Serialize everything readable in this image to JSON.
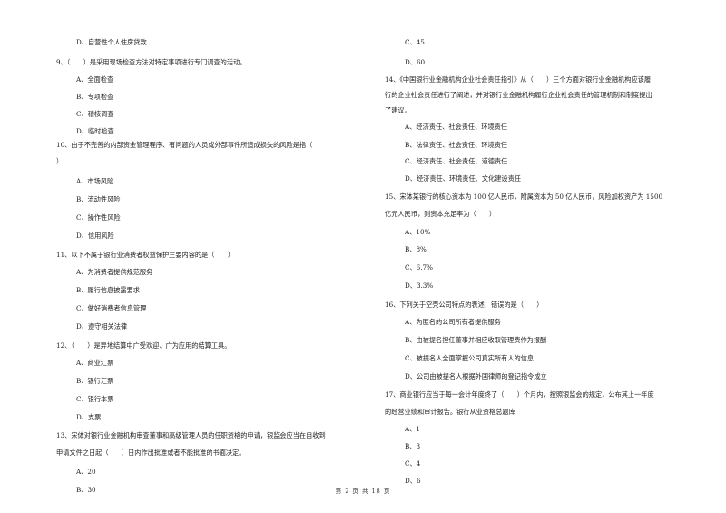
{
  "left_column": [
    {
      "type": "option",
      "text": "D、自营性个人住房贷款"
    },
    {
      "type": "question",
      "text": "9、（　　）是采用现场检查方法对特定事项进行专门调查的活动。"
    },
    {
      "type": "option",
      "text": "A、全面检查"
    },
    {
      "type": "option",
      "text": "B、专项检查"
    },
    {
      "type": "option",
      "text": "C、稽核调查"
    },
    {
      "type": "option",
      "text": "D、临时检查"
    },
    {
      "type": "question",
      "text": "10、由于不完善的内部资金管理程序、有问题的人员或外部事件所造成损失的风险是指（"
    },
    {
      "type": "question-cont",
      "text": "）"
    },
    {
      "type": "option",
      "text": "A、市场风险"
    },
    {
      "type": "option",
      "text": "B、流动性风险"
    },
    {
      "type": "option",
      "text": "C、操作性风险"
    },
    {
      "type": "option",
      "text": "D、信用风险"
    },
    {
      "type": "question",
      "text": "11、以下不属于银行业消费者权益保护主要内容的是（　　）"
    },
    {
      "type": "option",
      "text": "A、为消费者提供规范服务"
    },
    {
      "type": "option",
      "text": "B、履行信息披露要求"
    },
    {
      "type": "option",
      "text": "C、做好消费者信息管理"
    },
    {
      "type": "option",
      "text": "D、遵守相关法律"
    },
    {
      "type": "question",
      "text": "12、（　　）是异地结算中广受欢迎、广为应用的结算工具。"
    },
    {
      "type": "option",
      "text": "A、商业汇票"
    },
    {
      "type": "option",
      "text": "B、银行汇票"
    },
    {
      "type": "option",
      "text": "C、银行本票"
    },
    {
      "type": "option",
      "text": "D、支票"
    },
    {
      "type": "question",
      "text": "13、宋体对银行业金融机构审查董事和高级管理人员的任职资格的申请，银监会应当在自收到"
    },
    {
      "type": "question-cont",
      "text": "申请文件之日起（　　）日内作出批准或者不能批准的书面决定。"
    },
    {
      "type": "option",
      "text": "A、20"
    },
    {
      "type": "option",
      "text": "B、30"
    }
  ],
  "right_column": [
    {
      "type": "option",
      "text": "C、45"
    },
    {
      "type": "option",
      "text": "D、60"
    },
    {
      "type": "question",
      "text": "14、《中国银行业金融机构企业社会责任指引》从（　　）三个方面对银行业金融机构应该履"
    },
    {
      "type": "question-cont",
      "text": "行的企业社会责任进行了阐述，并对银行业金融机构履行企业社会责任的管理机制和制度提出"
    },
    {
      "type": "question-cont",
      "text": "了建议。"
    },
    {
      "type": "option",
      "text": "A、经济责任、社会责任、环境责任"
    },
    {
      "type": "option",
      "text": "B、法律责任、社会责任、环境责任"
    },
    {
      "type": "option",
      "text": "C、经济责任、社会责任、道德责任"
    },
    {
      "type": "option",
      "text": "D、经济责任、环境责任、文化建设责任"
    },
    {
      "type": "question",
      "text": "15、宋体某银行的核心资本为 100 亿人民币，附属资本为 50 亿人民币，风险加权资产为 1500"
    },
    {
      "type": "question-cont",
      "text": "亿元人民币，则资本充足率为（　　）"
    },
    {
      "type": "option",
      "text": "A、10%"
    },
    {
      "type": "option",
      "text": "B、8%"
    },
    {
      "type": "option",
      "text": "C、6.7%"
    },
    {
      "type": "option",
      "text": "D、3.3%"
    },
    {
      "type": "question",
      "text": "16、下列关于空壳公司特点的表述，错误的是（　　）"
    },
    {
      "type": "option",
      "text": "A、为匿名的公司所有者提供服务"
    },
    {
      "type": "option",
      "text": "B、由被提名担任董事并相应收取管理费作为报酬"
    },
    {
      "type": "option",
      "text": "C、被提名人全面掌握公司真实所有人的信息"
    },
    {
      "type": "option",
      "text": "D、公司由被提名人根据外国律师的登记指令成立"
    },
    {
      "type": "question",
      "text": "17、商业银行应当于每一会计年度终了（　　）个月内，按照银监会的规定，公布其上一年度"
    },
    {
      "type": "question-cont",
      "text": "的经营业绩和审计报告。银行从业资格总题库"
    },
    {
      "type": "option",
      "text": "A、1"
    },
    {
      "type": "option",
      "text": "B、3"
    },
    {
      "type": "option",
      "text": "C、4"
    },
    {
      "type": "option",
      "text": "D、6"
    }
  ],
  "footer": {
    "text": "第 2 页 共 18 页"
  }
}
